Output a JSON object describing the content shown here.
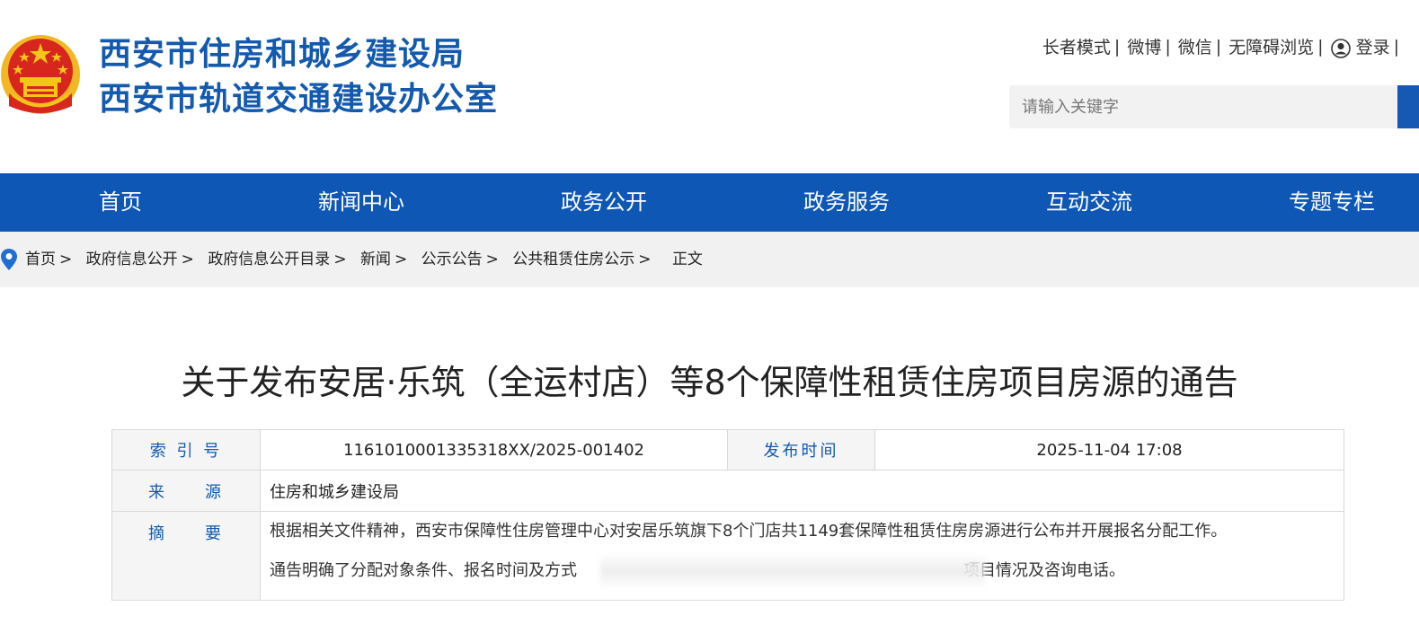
{
  "header": {
    "title_line1": "西安市住房和城乡建设局",
    "title_line2": "西安市轨道交通建设办公室",
    "links": [
      "长者模式",
      "微博",
      "微信",
      "无障碍浏览"
    ],
    "login_label": "登录",
    "search_placeholder": "请输入关键字"
  },
  "nav": {
    "items": [
      "首页",
      "新闻中心",
      "政务公开",
      "政务服务",
      "互动交流",
      "专题专栏"
    ]
  },
  "breadcrumb": {
    "items": [
      "首页",
      "政府信息公开",
      "政府信息公开目录",
      "新闻",
      "公示公告",
      "公共租赁住房公示"
    ],
    "separator": ">",
    "current": "正文"
  },
  "article": {
    "title": "关于发布安居·乐筑（全运村店）等8个保障性租赁住房项目房源的通告",
    "index_label": "索 引 号",
    "index_value": "116101000133531​8XX/2025-001402",
    "date_label": "发布时间",
    "date_value": "2025-11-04 17:08",
    "source_label": "来　　源",
    "source_value": "住房和城乡建设局",
    "summary_label": "摘　　要",
    "summary_line1": "根据相关文件精神，西安市保障性住房管理中心对安居乐筑旗下8个门店共1149套保障性租赁住房房源进行公布并开展报名分配工作。",
    "summary_line2_start": "通告明确了分配对象条件、报名时间及方式",
    "summary_line2_end": "项目情况及咨询电话。"
  },
  "colors": {
    "brand_blue": "#1359ad",
    "nav_blue": "#0e57b4",
    "emblem_red": "#d7261d",
    "emblem_gold": "#f5c518"
  }
}
